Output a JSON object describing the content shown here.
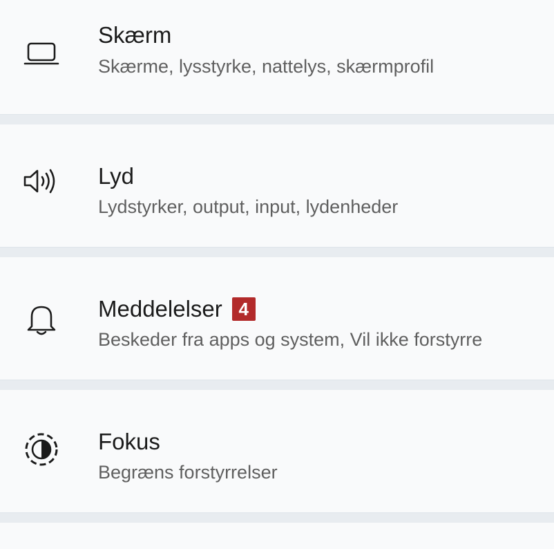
{
  "colors": {
    "badge_bg": "#b22a2a"
  },
  "items": [
    {
      "title": "Skærm",
      "subtitle": "Skærme, lysstyrke, nattelys, skærmprofil",
      "icon": "display-icon"
    },
    {
      "title": "Lyd",
      "subtitle": "Lydstyrker, output, input, lydenheder",
      "icon": "speaker-icon"
    },
    {
      "title": "Meddelelser",
      "subtitle": "Beskeder fra apps og system, Vil ikke forstyrre",
      "icon": "bell-icon",
      "badge": "4"
    },
    {
      "title": "Fokus",
      "subtitle": "Begræns forstyrrelser",
      "icon": "focus-icon"
    }
  ]
}
